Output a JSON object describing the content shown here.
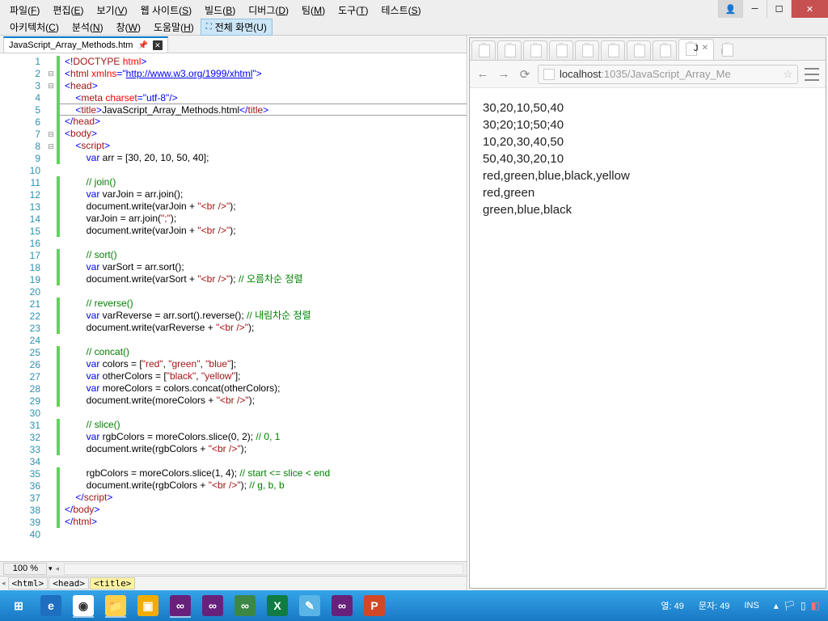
{
  "menu": {
    "row1": [
      {
        "label": "파일",
        "u": "F"
      },
      {
        "label": "편집",
        "u": "E"
      },
      {
        "label": "보기",
        "u": "V"
      },
      {
        "label": "웹 사이트",
        "u": "S"
      },
      {
        "label": "빌드",
        "u": "B"
      },
      {
        "label": "디버그",
        "u": "D"
      },
      {
        "label": "팀",
        "u": "M"
      },
      {
        "label": "도구",
        "u": "T"
      },
      {
        "label": "테스트",
        "u": "S"
      }
    ],
    "row2": [
      {
        "label": "아키텍처",
        "u": "C"
      },
      {
        "label": "분석",
        "u": "N"
      },
      {
        "label": "창",
        "u": "W"
      },
      {
        "label": "도움말",
        "u": "H"
      }
    ],
    "fullscreen": "전체 화면(U)"
  },
  "window_controls": {
    "user": "👤"
  },
  "editor": {
    "tab_label": "JavaScript_Array_Methods.htm",
    "zoom": "100 %",
    "breadcrumbs": [
      "<html>",
      "<head>",
      "<title>"
    ],
    "active_line": 5,
    "lines": [
      {
        "n": 1,
        "fold": "",
        "html": "<span class='c-bl'>&lt;!</span><span class='c-br'>DOCTYPE</span> <span class='c-rd'>html</span><span class='c-bl'>&gt;</span>"
      },
      {
        "n": 2,
        "fold": "⊟",
        "html": "<span class='c-bl'>&lt;</span><span class='c-br'>html</span> <span class='c-rd'>xmlns</span><span class='c-bl'>=</span><span class='c-bl'>\"</span><span class='c-lnk'>http://www.w3.org/1999/xhtml</span><span class='c-bl'>\"&gt;</span>"
      },
      {
        "n": 3,
        "fold": "⊟",
        "html": "<span class='c-bl'>&lt;</span><span class='c-br'>head</span><span class='c-bl'>&gt;</span>"
      },
      {
        "n": 4,
        "fold": "",
        "html": "    <span class='c-bl'>&lt;</span><span class='c-br'>meta</span> <span class='c-rd'>charset</span><span class='c-bl'>=\"utf-8\"/&gt;</span>"
      },
      {
        "n": 5,
        "fold": "",
        "html": "    <span class='c-bl'>&lt;</span><span class='c-br'>title</span><span class='c-bl'>&gt;</span>JavaScript_Array_Methods.html<span class='c-bl'>&lt;/</span><span class='c-br'>title</span><span class='c-bl'>&gt;</span>"
      },
      {
        "n": 6,
        "fold": "",
        "html": "<span class='c-bl'>&lt;/</span><span class='c-br'>head</span><span class='c-bl'>&gt;</span>"
      },
      {
        "n": 7,
        "fold": "⊟",
        "html": "<span class='c-bl'>&lt;</span><span class='c-br'>body</span><span class='c-bl'>&gt;</span>"
      },
      {
        "n": 8,
        "fold": "⊟",
        "html": "    <span class='c-bl'>&lt;</span><span class='c-br'>script</span><span class='c-bl'>&gt;</span>"
      },
      {
        "n": 9,
        "fold": "",
        "html": "        <span class='c-bl'>var</span> arr = [30, 20, 10, 50, 40];"
      },
      {
        "n": 10,
        "fold": "",
        "html": ""
      },
      {
        "n": 11,
        "fold": "",
        "html": "        <span class='c-gn'>// join()</span>"
      },
      {
        "n": 12,
        "fold": "",
        "html": "        <span class='c-bl'>var</span> varJoin = arr.join();"
      },
      {
        "n": 13,
        "fold": "",
        "html": "        document.write(varJoin + <span class='c-br'>\"&lt;br /&gt;\"</span>);"
      },
      {
        "n": 14,
        "fold": "",
        "html": "        varJoin = arr.join(<span class='c-br'>\";\"</span>);"
      },
      {
        "n": 15,
        "fold": "",
        "html": "        document.write(varJoin + <span class='c-br'>\"&lt;br /&gt;\"</span>);"
      },
      {
        "n": 16,
        "fold": "",
        "html": ""
      },
      {
        "n": 17,
        "fold": "",
        "html": "        <span class='c-gn'>// sort()</span>"
      },
      {
        "n": 18,
        "fold": "",
        "html": "        <span class='c-bl'>var</span> varSort = arr.sort();"
      },
      {
        "n": 19,
        "fold": "",
        "html": "        document.write(varSort + <span class='c-br'>\"&lt;br /&gt;\"</span>); <span class='c-gn'>// 오름차순 정렬</span>"
      },
      {
        "n": 20,
        "fold": "",
        "html": ""
      },
      {
        "n": 21,
        "fold": "",
        "html": "        <span class='c-gn'>// reverse()</span>"
      },
      {
        "n": 22,
        "fold": "",
        "html": "        <span class='c-bl'>var</span> varReverse = arr.sort().reverse(); <span class='c-gn'>// 내림차순 정렬</span>"
      },
      {
        "n": 23,
        "fold": "",
        "html": "        document.write(varReverse + <span class='c-br'>\"&lt;br /&gt;\"</span>);"
      },
      {
        "n": 24,
        "fold": "",
        "html": ""
      },
      {
        "n": 25,
        "fold": "",
        "html": "        <span class='c-gn'>// concat()</span>"
      },
      {
        "n": 26,
        "fold": "",
        "html": "        <span class='c-bl'>var</span> colors = [<span class='c-br'>\"red\"</span>, <span class='c-br'>\"green\"</span>, <span class='c-br'>\"blue\"</span>];"
      },
      {
        "n": 27,
        "fold": "",
        "html": "        <span class='c-bl'>var</span> otherColors = [<span class='c-br'>\"black\"</span>, <span class='c-br'>\"yellow\"</span>];"
      },
      {
        "n": 28,
        "fold": "",
        "html": "        <span class='c-bl'>var</span> moreColors = colors.concat(otherColors);"
      },
      {
        "n": 29,
        "fold": "",
        "html": "        document.write(moreColors + <span class='c-br'>\"&lt;br /&gt;\"</span>);"
      },
      {
        "n": 30,
        "fold": "",
        "html": ""
      },
      {
        "n": 31,
        "fold": "",
        "html": "        <span class='c-gn'>// slice()</span>"
      },
      {
        "n": 32,
        "fold": "",
        "html": "        <span class='c-bl'>var</span> rgbColors = moreColors.slice(0, 2); <span class='c-gn'>// 0, 1</span>"
      },
      {
        "n": 33,
        "fold": "",
        "html": "        document.write(rgbColors + <span class='c-br'>\"&lt;br /&gt;\"</span>);"
      },
      {
        "n": 34,
        "fold": "",
        "html": ""
      },
      {
        "n": 35,
        "fold": "",
        "html": "        rgbColors = moreColors.slice(1, 4); <span class='c-gn'>// start &lt;= slice &lt; end</span>"
      },
      {
        "n": 36,
        "fold": "",
        "html": "        document.write(rgbColors + <span class='c-br'>\"&lt;br /&gt;\"</span>); <span class='c-gn'>// g, b, b</span>"
      },
      {
        "n": 37,
        "fold": "",
        "html": "    <span class='c-bl'>&lt;/</span><span class='c-br'>script</span><span class='c-bl'>&gt;</span>"
      },
      {
        "n": 38,
        "fold": "",
        "html": "<span class='c-bl'>&lt;/</span><span class='c-br'>body</span><span class='c-bl'>&gt;</span>"
      },
      {
        "n": 39,
        "fold": "",
        "html": "<span class='c-bl'>&lt;/</span><span class='c-br'>html</span><span class='c-bl'>&gt;</span>"
      },
      {
        "n": 40,
        "fold": "",
        "html": ""
      }
    ]
  },
  "browser": {
    "active_tab_label": "J",
    "url_host": "localhost",
    "url_port": ":1035",
    "url_path": "/JavaScript_Array_Me",
    "output": [
      "30,20,10,50,40",
      "30;20;10;50;40",
      "10,20,30,40,50",
      "50,40,30,20,10",
      "red,green,blue,black,yellow",
      "red,green",
      "green,blue,black"
    ]
  },
  "status": {
    "col_label": "열:",
    "col_val": "49",
    "char_label": "문자:",
    "char_val": "49",
    "ins": "INS"
  },
  "taskbar": {
    "apps": [
      {
        "name": "start",
        "bg": "transparent",
        "txt": "⊞",
        "active": false
      },
      {
        "name": "ie",
        "bg": "#1e6fbf",
        "txt": "e",
        "active": false
      },
      {
        "name": "chrome",
        "bg": "#fff",
        "txt": "◉",
        "active": true
      },
      {
        "name": "explorer",
        "bg": "#ffcf4b",
        "txt": "📁",
        "active": true
      },
      {
        "name": "sql",
        "bg": "#f0ad00",
        "txt": "▣",
        "active": false
      },
      {
        "name": "vs1",
        "bg": "#68217a",
        "txt": "∞",
        "active": true
      },
      {
        "name": "vs2",
        "bg": "#68217a",
        "txt": "∞",
        "active": false
      },
      {
        "name": "vs3",
        "bg": "#3c8746",
        "txt": "∞",
        "active": false
      },
      {
        "name": "excel",
        "bg": "#107c41",
        "txt": "X",
        "active": false
      },
      {
        "name": "notepad",
        "bg": "#5ab4e6",
        "txt": "✎",
        "active": false
      },
      {
        "name": "vs4",
        "bg": "#68217a",
        "txt": "∞",
        "active": false
      },
      {
        "name": "ppt",
        "bg": "#d24726",
        "txt": "P",
        "active": false
      }
    ]
  }
}
